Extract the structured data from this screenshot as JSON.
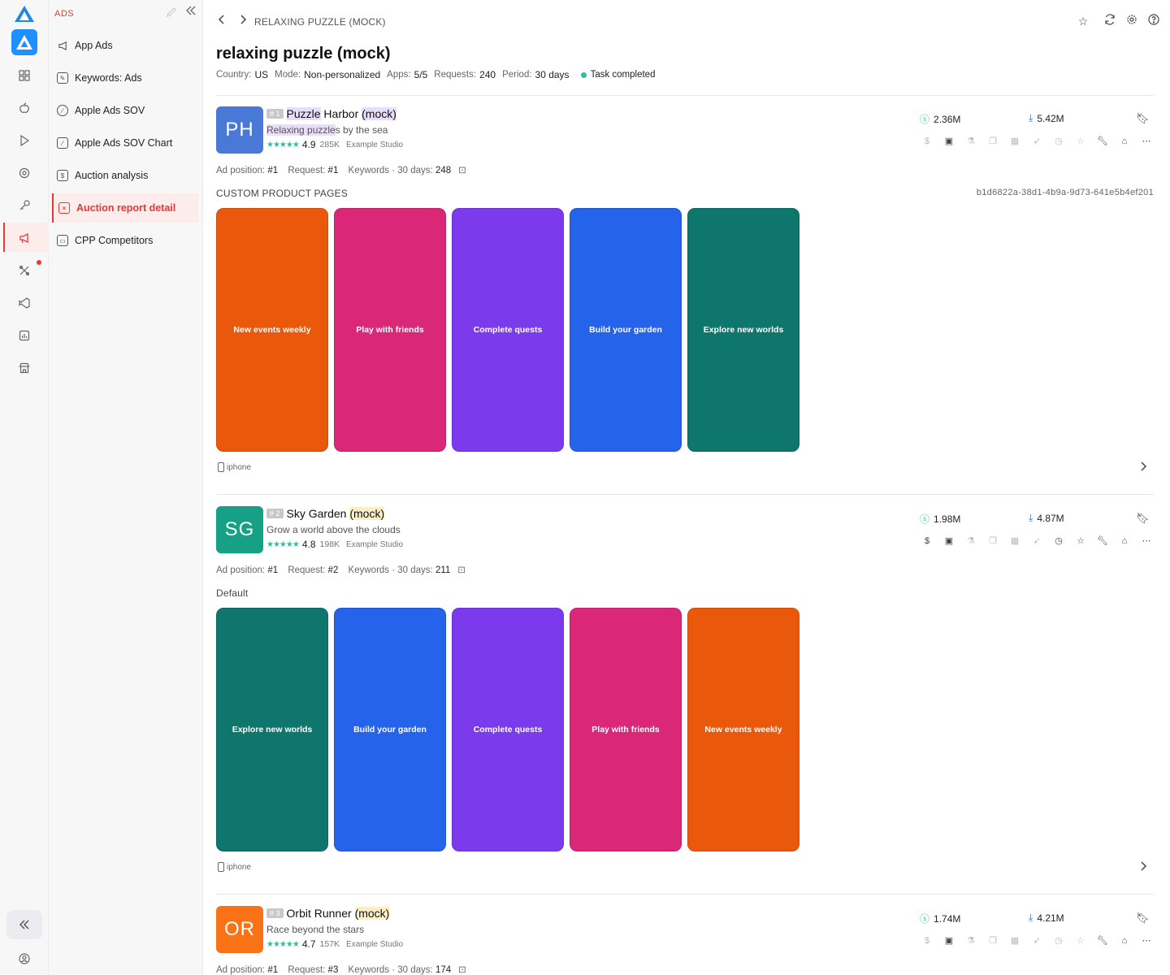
{
  "rail": {
    "icons": [
      "apps-icon",
      "apple-icon",
      "play-icon",
      "target-icon",
      "key-icon",
      "megaphone-icon",
      "tools-icon",
      "vscode-icon",
      "chart-icon",
      "store-icon"
    ],
    "collapse_icon": "double-chevron-left-icon",
    "user_icon": "user-circle-icon"
  },
  "sidebar": {
    "header": "ADS",
    "items": [
      {
        "label": "App Ads",
        "icon": "megaphone-icon"
      },
      {
        "label": "Keywords: Ads",
        "icon": "edit-icon"
      },
      {
        "label": "Apple Ads SOV",
        "icon": "compass-icon"
      },
      {
        "label": "Apple Ads SOV Chart",
        "icon": "chart-line-icon"
      },
      {
        "label": "Auction analysis",
        "icon": "document-icon"
      },
      {
        "label": "Auction report detail",
        "icon": "report-icon",
        "active": true
      },
      {
        "label": "CPP Competitors",
        "icon": "stack-icon"
      }
    ]
  },
  "header": {
    "breadcrumb": "RELAXING PUZZLE (MOCK)",
    "title": "relaxing puzzle (mock)",
    "meta": {
      "country_label": "Country:",
      "country": "US",
      "mode_label": "Mode:",
      "mode": "Non-personalized",
      "apps_label": "Apps:",
      "apps": "5/5",
      "requests_label": "Requests:",
      "requests": "240",
      "period_label": "Period:",
      "period": "30 days",
      "status": "Task completed"
    }
  },
  "labels": {
    "ad_position": "Ad position:",
    "request": "Request:",
    "keywords": "Keywords · 30 days:",
    "device": "iphone"
  },
  "apps": [
    {
      "initials": "PH",
      "color": "#4a78d6",
      "rank": "# 1",
      "name_a": "Puzzle",
      "name_b": " Harbor ",
      "name_c": "(mock)",
      "sub_a": "Relaxing puzzle",
      "sub_b": "s by the sea",
      "rating": "4.9",
      "ratings_count": "285K",
      "developer": "Example Studio",
      "revenue": "2.36M",
      "downloads": "5.42M",
      "ad_position": "#1",
      "request": "#1",
      "keywords": "248",
      "section": "CUSTOM PRODUCT PAGES",
      "cpp_id": "b1d6822a-38d1-4b9a-9d73-641e5b4ef201",
      "screens": [
        {
          "text": "New events weekly",
          "color": "#ea580c"
        },
        {
          "text": "Play with friends",
          "color": "#db2777"
        },
        {
          "text": "Complete quests",
          "color": "#7c3aed"
        },
        {
          "text": "Build your garden",
          "color": "#2563eb"
        },
        {
          "text": "Explore new worlds",
          "color": "#0f766e"
        }
      ]
    },
    {
      "initials": "SG",
      "color": "#16a085",
      "rank": "# 2",
      "name_a": "",
      "name_b": "Sky Garden ",
      "name_c": "(mock)",
      "sub_a": "",
      "sub_b": "Grow a world above the clouds",
      "rating": "4.8",
      "ratings_count": "198K",
      "developer": "Example Studio",
      "revenue": "1.98M",
      "downloads": "4.87M",
      "ad_position": "#1",
      "request": "#2",
      "keywords": "211",
      "section": "Default",
      "cpp_id": "",
      "screens": [
        {
          "text": "Explore new worlds",
          "color": "#0f766e"
        },
        {
          "text": "Build your garden",
          "color": "#2563eb"
        },
        {
          "text": "Complete quests",
          "color": "#7c3aed"
        },
        {
          "text": "Play with friends",
          "color": "#db2777"
        },
        {
          "text": "New events weekly",
          "color": "#ea580c"
        }
      ]
    },
    {
      "initials": "OR",
      "color": "#f97316",
      "rank": "# 3",
      "name_a": "",
      "name_b": "Orbit Runner ",
      "name_c": "(mock)",
      "sub_a": "",
      "sub_b": "Race beyond the stars",
      "rating": "4.7",
      "ratings_count": "157K",
      "developer": "Example Studio",
      "revenue": "1.74M",
      "downloads": "4.21M",
      "ad_position": "#1",
      "request": "#3",
      "keywords": "174"
    }
  ]
}
